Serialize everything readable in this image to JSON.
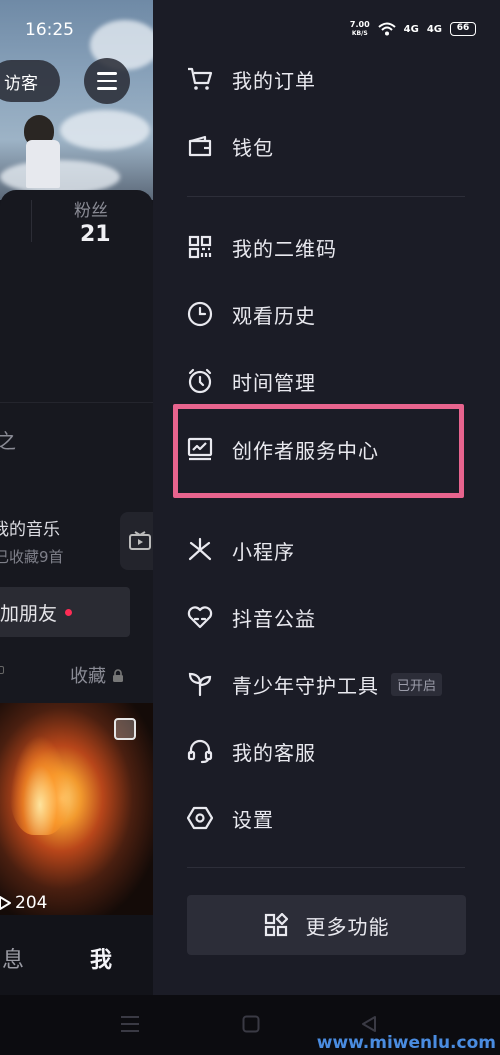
{
  "status_bar": {
    "time": "16:25",
    "net_speed_value": "7.00",
    "net_speed_unit": "KB/S",
    "signal_1": "4G",
    "signal_2": "4G",
    "battery": "66"
  },
  "profile": {
    "visitor_label": "访客",
    "fans_label": "粉丝",
    "fans_count": "21",
    "edit_hint": "之",
    "music_title": "我的音乐",
    "music_sub": "已收藏9首",
    "add_friend": "加朋友",
    "collect_tab": "收藏",
    "play_count": "204",
    "tab_message": "息",
    "tab_me": "我"
  },
  "drawer": {
    "items": [
      {
        "label": "我的订单",
        "icon": "cart-icon"
      },
      {
        "label": "钱包",
        "icon": "wallet-icon"
      },
      {
        "label": "我的二维码",
        "icon": "qrcode-icon"
      },
      {
        "label": "观看历史",
        "icon": "clock-icon"
      },
      {
        "label": "时间管理",
        "icon": "alarm-icon"
      },
      {
        "label": "创作者服务中心",
        "icon": "creator-chart-icon"
      },
      {
        "label": "小程序",
        "icon": "mini-program-icon"
      },
      {
        "label": "抖音公益",
        "icon": "charity-heart-icon"
      },
      {
        "label": "青少年守护工具",
        "icon": "sprout-icon",
        "badge": "已开启"
      },
      {
        "label": "我的客服",
        "icon": "headset-icon"
      },
      {
        "label": "设置",
        "icon": "settings-hexagon-icon"
      }
    ],
    "more_label": "更多功能"
  },
  "watermark": "www.miwenlu.com",
  "colors": {
    "drawer_bg": "#1b1c26",
    "highlight": "#e8648e",
    "notify_dot": "#fe2c55"
  }
}
